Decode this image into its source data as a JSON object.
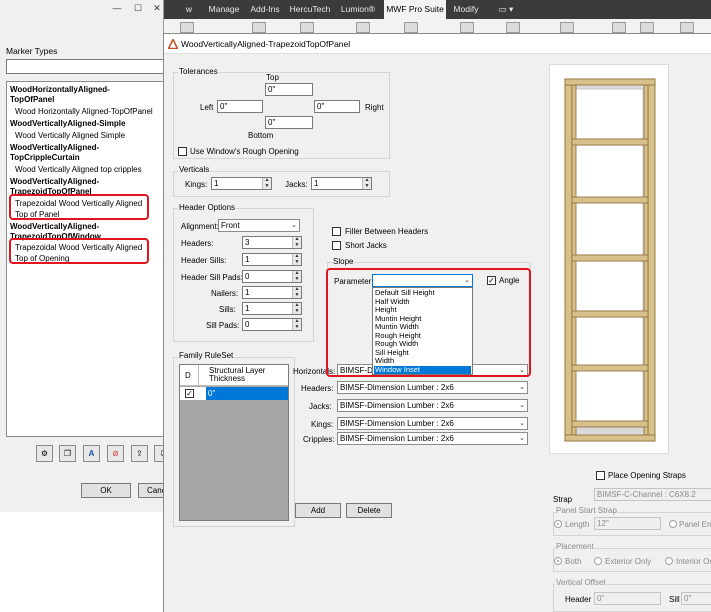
{
  "ribbon": {
    "tabs": [
      {
        "label": "w",
        "active": false
      },
      {
        "label": "Manage",
        "active": false
      },
      {
        "label": "Add-Ins",
        "active": false
      },
      {
        "label": "HercuTech",
        "active": false
      },
      {
        "label": "Lumion®",
        "active": false
      },
      {
        "label": "MWF Pro Suite",
        "active": true
      },
      {
        "label": "Modify",
        "active": false
      }
    ],
    "extra_control": "▭ ▾"
  },
  "left_window": {
    "controls": {
      "minimize": "—",
      "maximize": "☐",
      "close": "✕"
    },
    "marker_types_label": "Marker Types",
    "search_value": "",
    "items": [
      {
        "text": "WoodHorizontallyAligned-",
        "bold": true
      },
      {
        "text": "TopOfPanel",
        "bold": true
      },
      {
        "text": "Wood Horizontally Aligned-TopOfPanel",
        "bold": false
      },
      {
        "text": "WoodVerticallyAligned-Simple",
        "bold": true
      },
      {
        "text": "Wood Vertically Aligned Simple",
        "bold": false
      },
      {
        "text": "WoodVerticallyAligned-",
        "bold": true
      },
      {
        "text": "TopCrippleCurtain",
        "bold": true
      },
      {
        "text": "Wood Vertically Aligned top cripples",
        "bold": false
      },
      {
        "text": "WoodVerticallyAligned-",
        "bold": true
      },
      {
        "text": "TrapezoidTopOfPanel",
        "bold": true
      },
      {
        "text": "Trapezoidal Wood Vertically Aligned",
        "bold": false
      },
      {
        "text": "Top of Panel",
        "bold": false
      },
      {
        "text": "WoodVerticallyAligned-",
        "bold": true
      },
      {
        "text": "TrapezoidTopOfWindow",
        "bold": true
      },
      {
        "text": "Trapezoidal Wood Vertically Aligned",
        "bold": false
      },
      {
        "text": "Top of Opening",
        "bold": false
      }
    ],
    "toolbar_icons": [
      "settings-icon",
      "copy-icon",
      "font-icon",
      "delete-icon",
      "export-icon",
      "import-icon"
    ],
    "ok_label": "OK",
    "cancel_label": "Canc"
  },
  "dialog": {
    "title": "WoodVerticallyAligned-TrapezoidTopOfPanel",
    "tolerances": {
      "legend": "Tolerances",
      "top_label": "Top",
      "top_value": "0\"",
      "left_label": "Left",
      "left_value": "0\"",
      "right_label": "Right",
      "right_value": "0\"",
      "bottom_label": "Bottom",
      "bottom_value": "0\"",
      "rough_opening_label": "Use Window's Rough Opening",
      "rough_opening_checked": false
    },
    "verticals": {
      "legend": "Verticals",
      "kings_label": "Kings:",
      "kings_value": "1",
      "jacks_label": "Jacks:",
      "jacks_value": "1"
    },
    "header_options": {
      "legend": "Header Options",
      "alignment_label": "Alignment:",
      "alignment_value": "Front",
      "headers_label": "Headers:",
      "headers_value": "3",
      "header_sills_label": "Header Sills:",
      "header_sills_value": "1",
      "header_sill_pads_label": "Header Sill Pads:",
      "header_sill_pads_value": "0",
      "nailers_label": "Nailers:",
      "nailers_value": "1",
      "sills_label": "Sills:",
      "sills_value": "1",
      "sill_pads_label": "Sill Pads:",
      "sill_pads_value": "0"
    },
    "filler_between_headers_label": "Filler Between Headers",
    "short_jacks_label": "Short Jacks",
    "slope": {
      "legend": "Slope",
      "parameter_label": "Parameter:",
      "parameter_value": "",
      "angle_label": "Angle",
      "angle_checked": true,
      "options": [
        "Default Sill Height",
        "Half Width",
        "Height",
        "Muntin Height",
        "Muntin Width",
        "Rough Height",
        "Rough Width",
        "Sill Height",
        "Width",
        "Window Inset"
      ],
      "selected_index": 9
    },
    "family_ruleset": {
      "legend": "Family RuleSet",
      "col_d": "D",
      "col_thickness": "Structural Layer Thickness",
      "row_value": "0\"",
      "row_checked": true,
      "add_label": "Add",
      "delete_label": "Delete"
    },
    "families": {
      "horizontals_label": "Horizontals:",
      "horizontals_value": "BIMSF-Dim",
      "headers_label": "Headers:",
      "headers_value": "BIMSF-Dimension Lumber : 2x6",
      "jacks_label": "Jacks:",
      "jacks_value": "BIMSF-Dimension Lumber : 2x6",
      "kings_label": "Kings:",
      "kings_value": "BIMSF-Dimension Lumber : 2x6",
      "cripples_label": "Cripples:",
      "cripples_value": "BIMSF-Dimension Lumber : 2x6"
    },
    "strap": {
      "place_label": "Place Opening Straps",
      "strap_label": "Strap",
      "strap_value": "BIMSF-C-Channel : C6X8.2",
      "panel_start_legend": "Panel Start Strap",
      "length_label": "Length",
      "length_value": "12\"",
      "panel_end_label": "Panel End",
      "placement_legend": "Placement",
      "both_label": "Both",
      "exterior_label": "Exterior Only",
      "interior_label": "Interior On",
      "vertical_offset_legend": "Vertical Offset",
      "header_label": "Header",
      "header_value": "0\"",
      "sill_label": "Sill",
      "sill_value": "0\""
    }
  },
  "colors": {
    "highlight": "#e0151d",
    "selection": "#0078d7",
    "wood": "#d8c08a",
    "wood_edge": "#8a6a34",
    "panel_gray": "#d9d9d9"
  }
}
